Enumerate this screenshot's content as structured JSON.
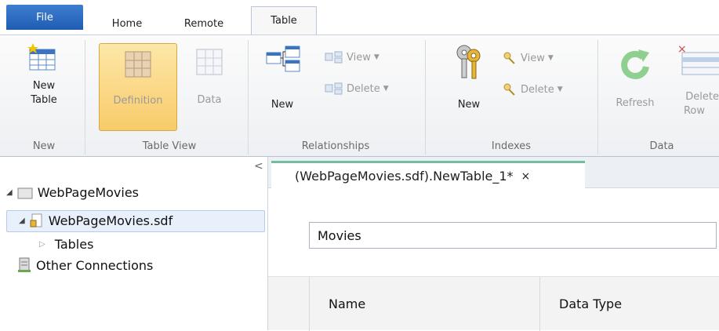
{
  "ribbon_tabs": {
    "file": "File",
    "home": "Home",
    "remote": "Remote",
    "table": "Table"
  },
  "groups": {
    "new": {
      "label": "New",
      "new_table_line1": "New",
      "new_table_line2": "Table"
    },
    "table_view": {
      "label": "Table View",
      "definition": "Definition",
      "data": "Data"
    },
    "relationships": {
      "label": "Relationships",
      "new": "New",
      "view": "View",
      "delete": "Delete"
    },
    "indexes": {
      "label": "Indexes",
      "new": "New",
      "view": "View",
      "delete": "Delete"
    },
    "data": {
      "label": "Data",
      "refresh": "Refresh",
      "delete_row_line1": "Delete",
      "delete_row_line2": "Row"
    }
  },
  "nav": {
    "collapse_glyph": "<",
    "tree": {
      "root": "WebPageMovies",
      "db": "WebPageMovies.sdf",
      "tables": "Tables",
      "other": "Other Connections"
    }
  },
  "document": {
    "tab_title": "(WebPageMovies.sdf).NewTable_1*",
    "close_glyph": "×",
    "table_name_value": "Movies",
    "columns": [
      "Name",
      "Data Type"
    ]
  },
  "colors": {
    "accent_tab": "#74bc9d",
    "file_tab": "#2a67bd",
    "selected_button": "#f8cb6a"
  }
}
